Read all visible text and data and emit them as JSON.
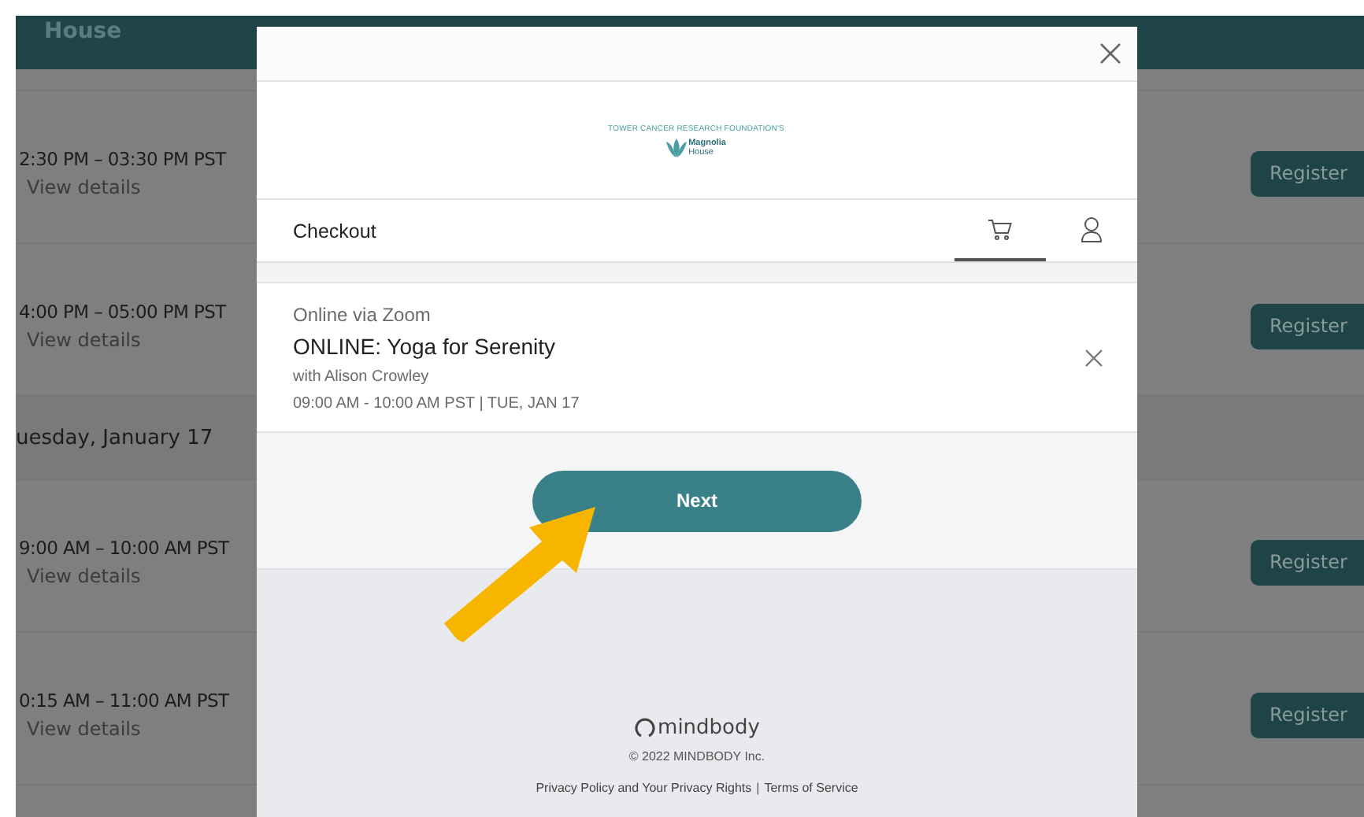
{
  "background_page": {
    "header": {
      "title": "House"
    },
    "schedule": [
      {
        "kind": "class",
        "time": "2:30 PM – 03:30 PM PST",
        "link": "View details",
        "button": "Register"
      },
      {
        "kind": "class",
        "time": "4:00 PM – 05:00 PM PST",
        "link": "View details",
        "button": "Register"
      },
      {
        "kind": "day",
        "label": "uesday, January 17"
      },
      {
        "kind": "class",
        "time": "9:00 AM – 10:00 AM PST",
        "link": "View details",
        "button": "Register"
      },
      {
        "kind": "class",
        "time": "0:15 AM – 11:00 AM PST",
        "link": "View details",
        "button": "Register"
      }
    ]
  },
  "modal": {
    "logo": {
      "caption": "TOWER CANCER RESEARCH FOUNDATION'S",
      "name_line1": "Magnolia",
      "name_line2": "House"
    },
    "title": "Checkout",
    "tabs": [
      {
        "kind": "cart",
        "selected": true
      },
      {
        "kind": "profile",
        "selected": false
      }
    ],
    "cart_item": {
      "location": "Online via Zoom",
      "name": "ONLINE: Yoga for Serenity",
      "instructor": "with Alison Crowley",
      "time": "09:00 AM - 10:00 AM PST | TUE, JAN 17"
    },
    "next_button": "Next",
    "footer": {
      "brand": "mindbody",
      "copyright": "© 2022 MINDBODY Inc.",
      "links": [
        {
          "label": "Privacy Policy and Your Privacy Rights"
        },
        {
          "label": "Terms of Service"
        }
      ],
      "separator": "|"
    }
  }
}
